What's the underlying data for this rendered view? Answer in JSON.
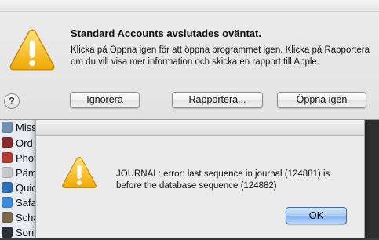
{
  "crash_dialog": {
    "title": "Standard Accounts avslutades oväntat.",
    "message": "Klicka på Öppna igen för att öppna programmet igen. Klicka på Rapportera om du vill visa mer information och skicka en rapport till Apple.",
    "help_label": "?",
    "buttons": {
      "ignore": "Ignorera",
      "report": "Rapportera...",
      "reopen": "Öppna igen"
    },
    "icon": "warning-triangle-icon"
  },
  "journal_dialog": {
    "message": "JOURNAL: error: last sequence in journal (124881) is before the database sequence (124882)",
    "ok_label": "OK",
    "icon": "warning-triangle-icon"
  },
  "background_list": {
    "items": [
      {
        "label": "Miss",
        "icon": "app-icon",
        "color": "#6f8fb3"
      },
      {
        "label": "Ord",
        "icon": "app-icon",
        "color": "#8a2b2b"
      },
      {
        "label": "Phot",
        "icon": "app-icon",
        "color": "#b33a2e"
      },
      {
        "label": "Päm",
        "icon": "app-icon",
        "color": "#c9c9c9"
      },
      {
        "label": "Quic",
        "icon": "app-icon",
        "color": "#2d6fb7"
      },
      {
        "label": "Safa",
        "icon": "app-icon",
        "color": "#3b8bd8"
      },
      {
        "label": "Scha",
        "icon": "app-icon",
        "color": "#7d6a4a"
      },
      {
        "label": "Son",
        "icon": "app-icon",
        "color": "#2f2f3a"
      }
    ]
  }
}
